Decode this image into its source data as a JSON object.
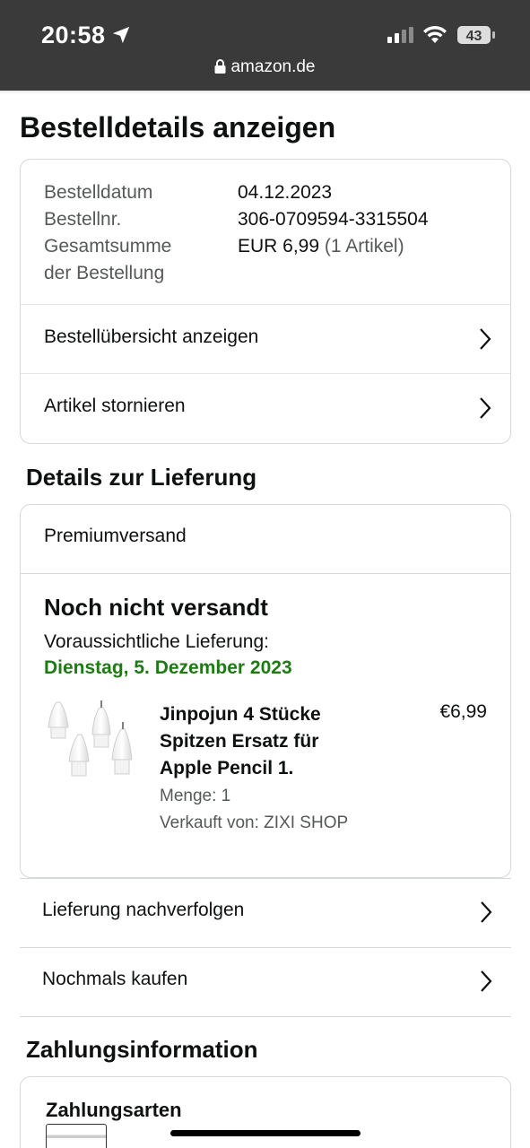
{
  "status_bar": {
    "time": "20:58",
    "battery": "43",
    "url": "amazon.de"
  },
  "page_title": "Bestelldetails anzeigen",
  "order_info": {
    "date_label": "Bestelldatum",
    "date_value": "04.12.2023",
    "number_label": "Bestellnr.",
    "number_value": "306-0709594-3315504",
    "total_label_line1": "Gesamtsumme",
    "total_label_line2": "der Bestellung",
    "total_value": "EUR 6,99",
    "total_items": "(1 Artikel)"
  },
  "order_actions": {
    "summary": "Bestellübersicht anzeigen",
    "cancel": "Artikel stornieren"
  },
  "delivery": {
    "heading": "Details zur Lieferung",
    "shipping_type": "Premiumversand",
    "status": "Noch nicht versandt",
    "expected_label": "Voraussichtliche Lieferung:",
    "expected_date": "Dienstag, 5. Dezember 2023",
    "product": {
      "title": "Jinpojun 4 Stücke Spitzen Ersatz für Apple Pencil 1.",
      "price": "€6,99",
      "quantity": "Menge: 1",
      "seller": "Verkauft von: ZIXI SHOP"
    },
    "track": "Lieferung nachverfolgen",
    "buy_again": "Nochmals kaufen"
  },
  "payment": {
    "heading": "Zahlungsinformation",
    "methods_title": "Zahlungsarten"
  },
  "colors": {
    "status_bar_bg": "#3a3a3a",
    "delivery_date": "#1e7b13",
    "muted_text": "#565959",
    "border": "#d5d9d9"
  }
}
